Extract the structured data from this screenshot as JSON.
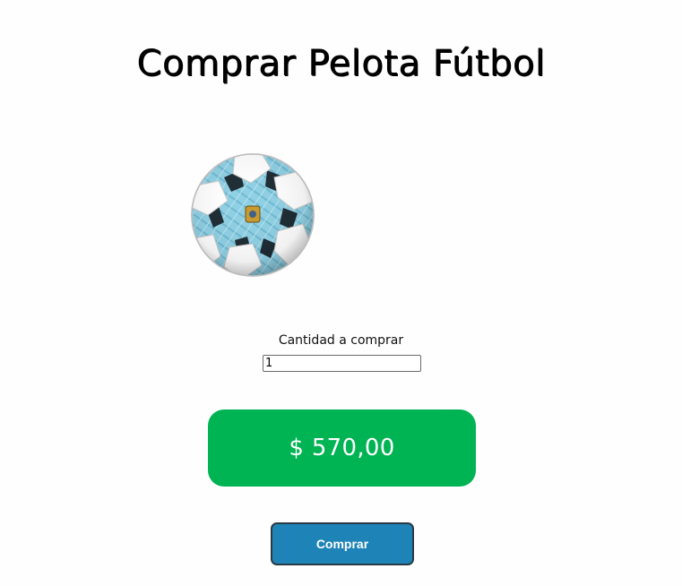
{
  "page": {
    "title": "Comprar Pelota Fútbol"
  },
  "product": {
    "image_icon": "soccer-ball-icon"
  },
  "quantity": {
    "label": "Cantidad a comprar",
    "value": "1"
  },
  "price": {
    "text": "$ 570,00"
  },
  "actions": {
    "buy_label": "Comprar"
  },
  "colors": {
    "price_bg": "#00b353",
    "button_bg": "#1e84b8",
    "ball_blue": "#8fd0e4"
  }
}
